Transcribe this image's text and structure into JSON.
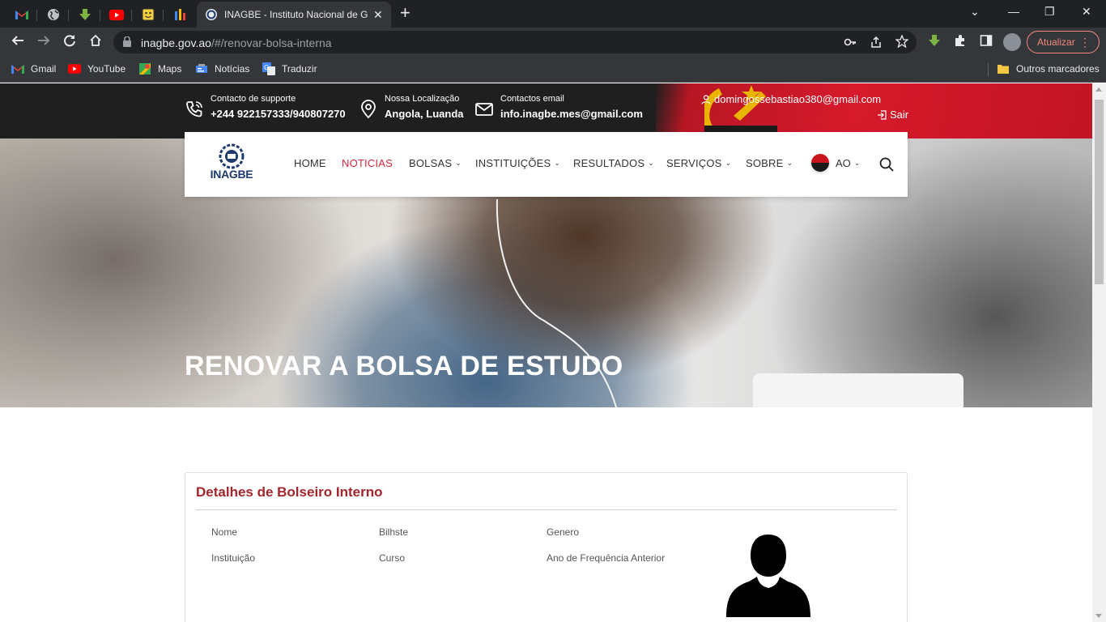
{
  "browser": {
    "active_tab_title": "INAGBE - Instituto Nacional de G",
    "url_domain": "inagbe.gov.ao",
    "url_path": "/#/renovar-bolsa-interna",
    "update_button": "Atualizar",
    "bookmarks": [
      {
        "label": "Gmail",
        "icon": "gmail-icon"
      },
      {
        "label": "YouTube",
        "icon": "youtube-icon"
      },
      {
        "label": "Maps",
        "icon": "maps-icon"
      },
      {
        "label": "Notícias",
        "icon": "news-icon"
      },
      {
        "label": "Traduzir",
        "icon": "translate-icon"
      }
    ],
    "other_bookmarks": "Outros marcadores"
  },
  "topbar": {
    "support_label": "Contacto de supporte",
    "support_value": "+244 922157333/940807270",
    "location_label": "Nossa Localização",
    "location_value": "Angola, Luanda",
    "email_label": "Contactos email",
    "email_value": "info.inagbe.mes@gmail.com",
    "user_email": "domingossebastiao380@gmail.com",
    "logout": "Sair"
  },
  "nav": {
    "logo_text": "INAGBE",
    "items": [
      {
        "label": "HOME",
        "dropdown": false
      },
      {
        "label": "NOTICIAS",
        "dropdown": false,
        "active": true
      },
      {
        "label": "BOLSAS",
        "dropdown": true
      },
      {
        "label": "INSTITUIÇÕES",
        "dropdown": true
      },
      {
        "label": "RESULTADOS",
        "dropdown": true
      },
      {
        "label": "SERVIÇOS",
        "dropdown": true
      },
      {
        "label": "SOBRE",
        "dropdown": true
      }
    ],
    "language": "AO"
  },
  "hero": {
    "title": "RENOVAR A BOLSA DE ESTUDO"
  },
  "details": {
    "title": "Detalhes de Bolseiro Interno",
    "fields": {
      "nome": "Nome",
      "bilhete": "Bilhste",
      "genero": "Genero",
      "instituicao": "Instituição",
      "curso": "Curso",
      "ano": "Ano de Frequência Anterior"
    }
  },
  "colors": {
    "accent_red": "#d6283b",
    "heading_red": "#a4262c",
    "topbar_bg": "#1f1f1f",
    "logo_blue": "#1f3a6e"
  }
}
